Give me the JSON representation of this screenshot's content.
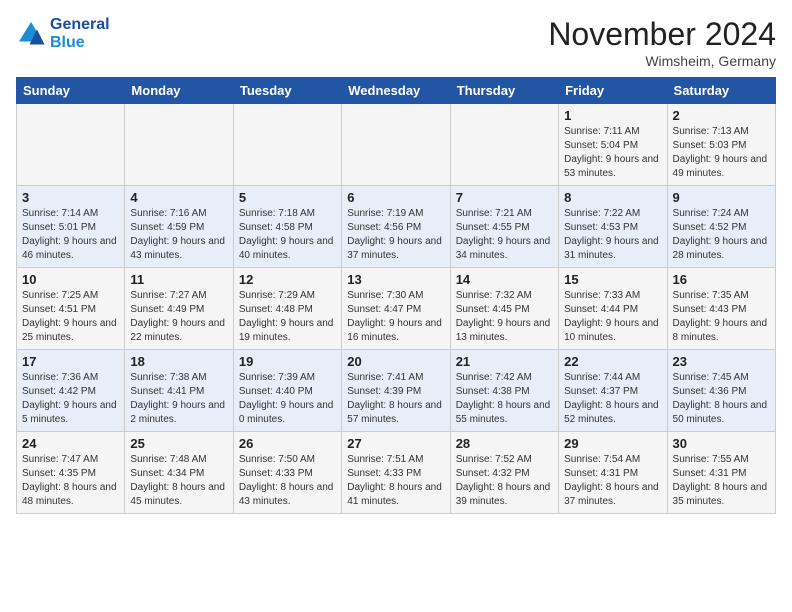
{
  "header": {
    "logo_line1": "General",
    "logo_line2": "Blue",
    "month_title": "November 2024",
    "location": "Wimsheim, Germany"
  },
  "days_of_week": [
    "Sunday",
    "Monday",
    "Tuesday",
    "Wednesday",
    "Thursday",
    "Friday",
    "Saturday"
  ],
  "weeks": [
    [
      {
        "day": "",
        "detail": ""
      },
      {
        "day": "",
        "detail": ""
      },
      {
        "day": "",
        "detail": ""
      },
      {
        "day": "",
        "detail": ""
      },
      {
        "day": "",
        "detail": ""
      },
      {
        "day": "1",
        "detail": "Sunrise: 7:11 AM\nSunset: 5:04 PM\nDaylight: 9 hours and 53 minutes."
      },
      {
        "day": "2",
        "detail": "Sunrise: 7:13 AM\nSunset: 5:03 PM\nDaylight: 9 hours and 49 minutes."
      }
    ],
    [
      {
        "day": "3",
        "detail": "Sunrise: 7:14 AM\nSunset: 5:01 PM\nDaylight: 9 hours and 46 minutes."
      },
      {
        "day": "4",
        "detail": "Sunrise: 7:16 AM\nSunset: 4:59 PM\nDaylight: 9 hours and 43 minutes."
      },
      {
        "day": "5",
        "detail": "Sunrise: 7:18 AM\nSunset: 4:58 PM\nDaylight: 9 hours and 40 minutes."
      },
      {
        "day": "6",
        "detail": "Sunrise: 7:19 AM\nSunset: 4:56 PM\nDaylight: 9 hours and 37 minutes."
      },
      {
        "day": "7",
        "detail": "Sunrise: 7:21 AM\nSunset: 4:55 PM\nDaylight: 9 hours and 34 minutes."
      },
      {
        "day": "8",
        "detail": "Sunrise: 7:22 AM\nSunset: 4:53 PM\nDaylight: 9 hours and 31 minutes."
      },
      {
        "day": "9",
        "detail": "Sunrise: 7:24 AM\nSunset: 4:52 PM\nDaylight: 9 hours and 28 minutes."
      }
    ],
    [
      {
        "day": "10",
        "detail": "Sunrise: 7:25 AM\nSunset: 4:51 PM\nDaylight: 9 hours and 25 minutes."
      },
      {
        "day": "11",
        "detail": "Sunrise: 7:27 AM\nSunset: 4:49 PM\nDaylight: 9 hours and 22 minutes."
      },
      {
        "day": "12",
        "detail": "Sunrise: 7:29 AM\nSunset: 4:48 PM\nDaylight: 9 hours and 19 minutes."
      },
      {
        "day": "13",
        "detail": "Sunrise: 7:30 AM\nSunset: 4:47 PM\nDaylight: 9 hours and 16 minutes."
      },
      {
        "day": "14",
        "detail": "Sunrise: 7:32 AM\nSunset: 4:45 PM\nDaylight: 9 hours and 13 minutes."
      },
      {
        "day": "15",
        "detail": "Sunrise: 7:33 AM\nSunset: 4:44 PM\nDaylight: 9 hours and 10 minutes."
      },
      {
        "day": "16",
        "detail": "Sunrise: 7:35 AM\nSunset: 4:43 PM\nDaylight: 9 hours and 8 minutes."
      }
    ],
    [
      {
        "day": "17",
        "detail": "Sunrise: 7:36 AM\nSunset: 4:42 PM\nDaylight: 9 hours and 5 minutes."
      },
      {
        "day": "18",
        "detail": "Sunrise: 7:38 AM\nSunset: 4:41 PM\nDaylight: 9 hours and 2 minutes."
      },
      {
        "day": "19",
        "detail": "Sunrise: 7:39 AM\nSunset: 4:40 PM\nDaylight: 9 hours and 0 minutes."
      },
      {
        "day": "20",
        "detail": "Sunrise: 7:41 AM\nSunset: 4:39 PM\nDaylight: 8 hours and 57 minutes."
      },
      {
        "day": "21",
        "detail": "Sunrise: 7:42 AM\nSunset: 4:38 PM\nDaylight: 8 hours and 55 minutes."
      },
      {
        "day": "22",
        "detail": "Sunrise: 7:44 AM\nSunset: 4:37 PM\nDaylight: 8 hours and 52 minutes."
      },
      {
        "day": "23",
        "detail": "Sunrise: 7:45 AM\nSunset: 4:36 PM\nDaylight: 8 hours and 50 minutes."
      }
    ],
    [
      {
        "day": "24",
        "detail": "Sunrise: 7:47 AM\nSunset: 4:35 PM\nDaylight: 8 hours and 48 minutes."
      },
      {
        "day": "25",
        "detail": "Sunrise: 7:48 AM\nSunset: 4:34 PM\nDaylight: 8 hours and 45 minutes."
      },
      {
        "day": "26",
        "detail": "Sunrise: 7:50 AM\nSunset: 4:33 PM\nDaylight: 8 hours and 43 minutes."
      },
      {
        "day": "27",
        "detail": "Sunrise: 7:51 AM\nSunset: 4:33 PM\nDaylight: 8 hours and 41 minutes."
      },
      {
        "day": "28",
        "detail": "Sunrise: 7:52 AM\nSunset: 4:32 PM\nDaylight: 8 hours and 39 minutes."
      },
      {
        "day": "29",
        "detail": "Sunrise: 7:54 AM\nSunset: 4:31 PM\nDaylight: 8 hours and 37 minutes."
      },
      {
        "day": "30",
        "detail": "Sunrise: 7:55 AM\nSunset: 4:31 PM\nDaylight: 8 hours and 35 minutes."
      }
    ]
  ]
}
